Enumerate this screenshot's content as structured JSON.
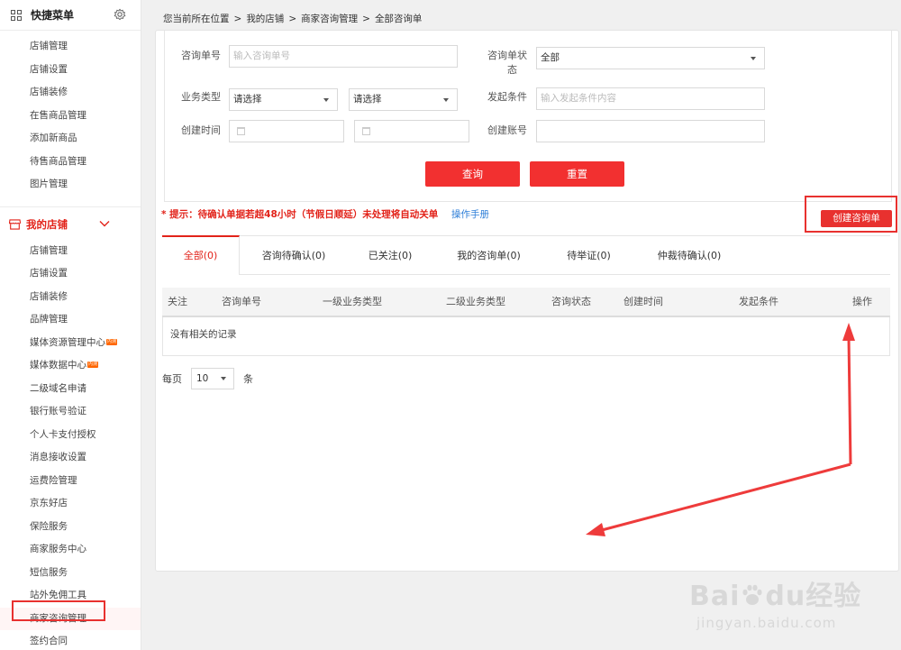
{
  "sidebar": {
    "quick_menu_title": "快捷菜单",
    "quick_items": [
      "店铺管理",
      "店铺设置",
      "店铺装修",
      "在售商品管理",
      "添加新商品",
      "待售商品管理",
      "图片管理"
    ],
    "group_title": "我的店铺",
    "store_items": [
      {
        "label": "店铺管理"
      },
      {
        "label": "店铺设置"
      },
      {
        "label": "店铺装修"
      },
      {
        "label": "品牌管理"
      },
      {
        "label": "媒体资源管理中心",
        "badge": "内测"
      },
      {
        "label": "媒体数据中心",
        "badge": "内测"
      },
      {
        "label": "二级域名申请"
      },
      {
        "label": "银行账号验证"
      },
      {
        "label": "个人卡支付授权"
      },
      {
        "label": "消息接收设置"
      },
      {
        "label": "运费险管理"
      },
      {
        "label": "京东好店"
      },
      {
        "label": "保险服务"
      },
      {
        "label": "商家服务中心"
      },
      {
        "label": "短信服务"
      },
      {
        "label": "站外免佣工具"
      },
      {
        "label": "商家咨询管理"
      },
      {
        "label": "签约合同"
      }
    ],
    "active_item": "商家咨询管理"
  },
  "breadcrumb": [
    "您当前所在位置",
    "我的店铺",
    "商家咨询管理",
    "全部咨询单"
  ],
  "breadcrumb_sep": ">",
  "filters": {
    "consult_no_label": "咨询单号",
    "consult_no_placeholder": "输入咨询单号",
    "status_label_line1": "咨询单状",
    "status_label_line2": "态",
    "status_value": "全部",
    "biz_type_label": "业务类型",
    "biz_type_value1": "请选择",
    "biz_type_value2": "请选择",
    "condition_label": "发起条件",
    "condition_placeholder": "输入发起条件内容",
    "created_time_label": "创建时间",
    "created_account_label": "创建账号",
    "query_button": "查询",
    "reset_button": "重置"
  },
  "tip": "* 提示：待确认单据若超48小时（节假日顺延）未处理将自动关单",
  "manual_link": "操作手册",
  "create_button": "创建咨询单",
  "tabs": [
    "全部(0)",
    "咨询待确认(0)",
    "已关注(0)",
    "我的咨询单(0)",
    "待举证(0)",
    "仲裁待确认(0)"
  ],
  "active_tab": 0,
  "table": {
    "columns": [
      "关注",
      "咨询单号",
      "一级业务类型",
      "二级业务类型",
      "咨询状态",
      "创建时间",
      "发起条件",
      "操作"
    ],
    "empty_text": "没有相关的记录"
  },
  "pager": {
    "per_page_label": "每页",
    "per_page_value": "10",
    "unit_label": "条"
  },
  "watermark": {
    "logo_text_a": "Bai",
    "logo_text_b": "du",
    "logo_text_c": "经验",
    "sub_text": "jingyan.baidu.com"
  },
  "colors": {
    "accent_red": "#e2231a",
    "button_red": "#f23030",
    "highlight_border": "#e8312f",
    "annotation_arrow": "#ee3b3b",
    "link_blue": "#2f7fd8"
  }
}
